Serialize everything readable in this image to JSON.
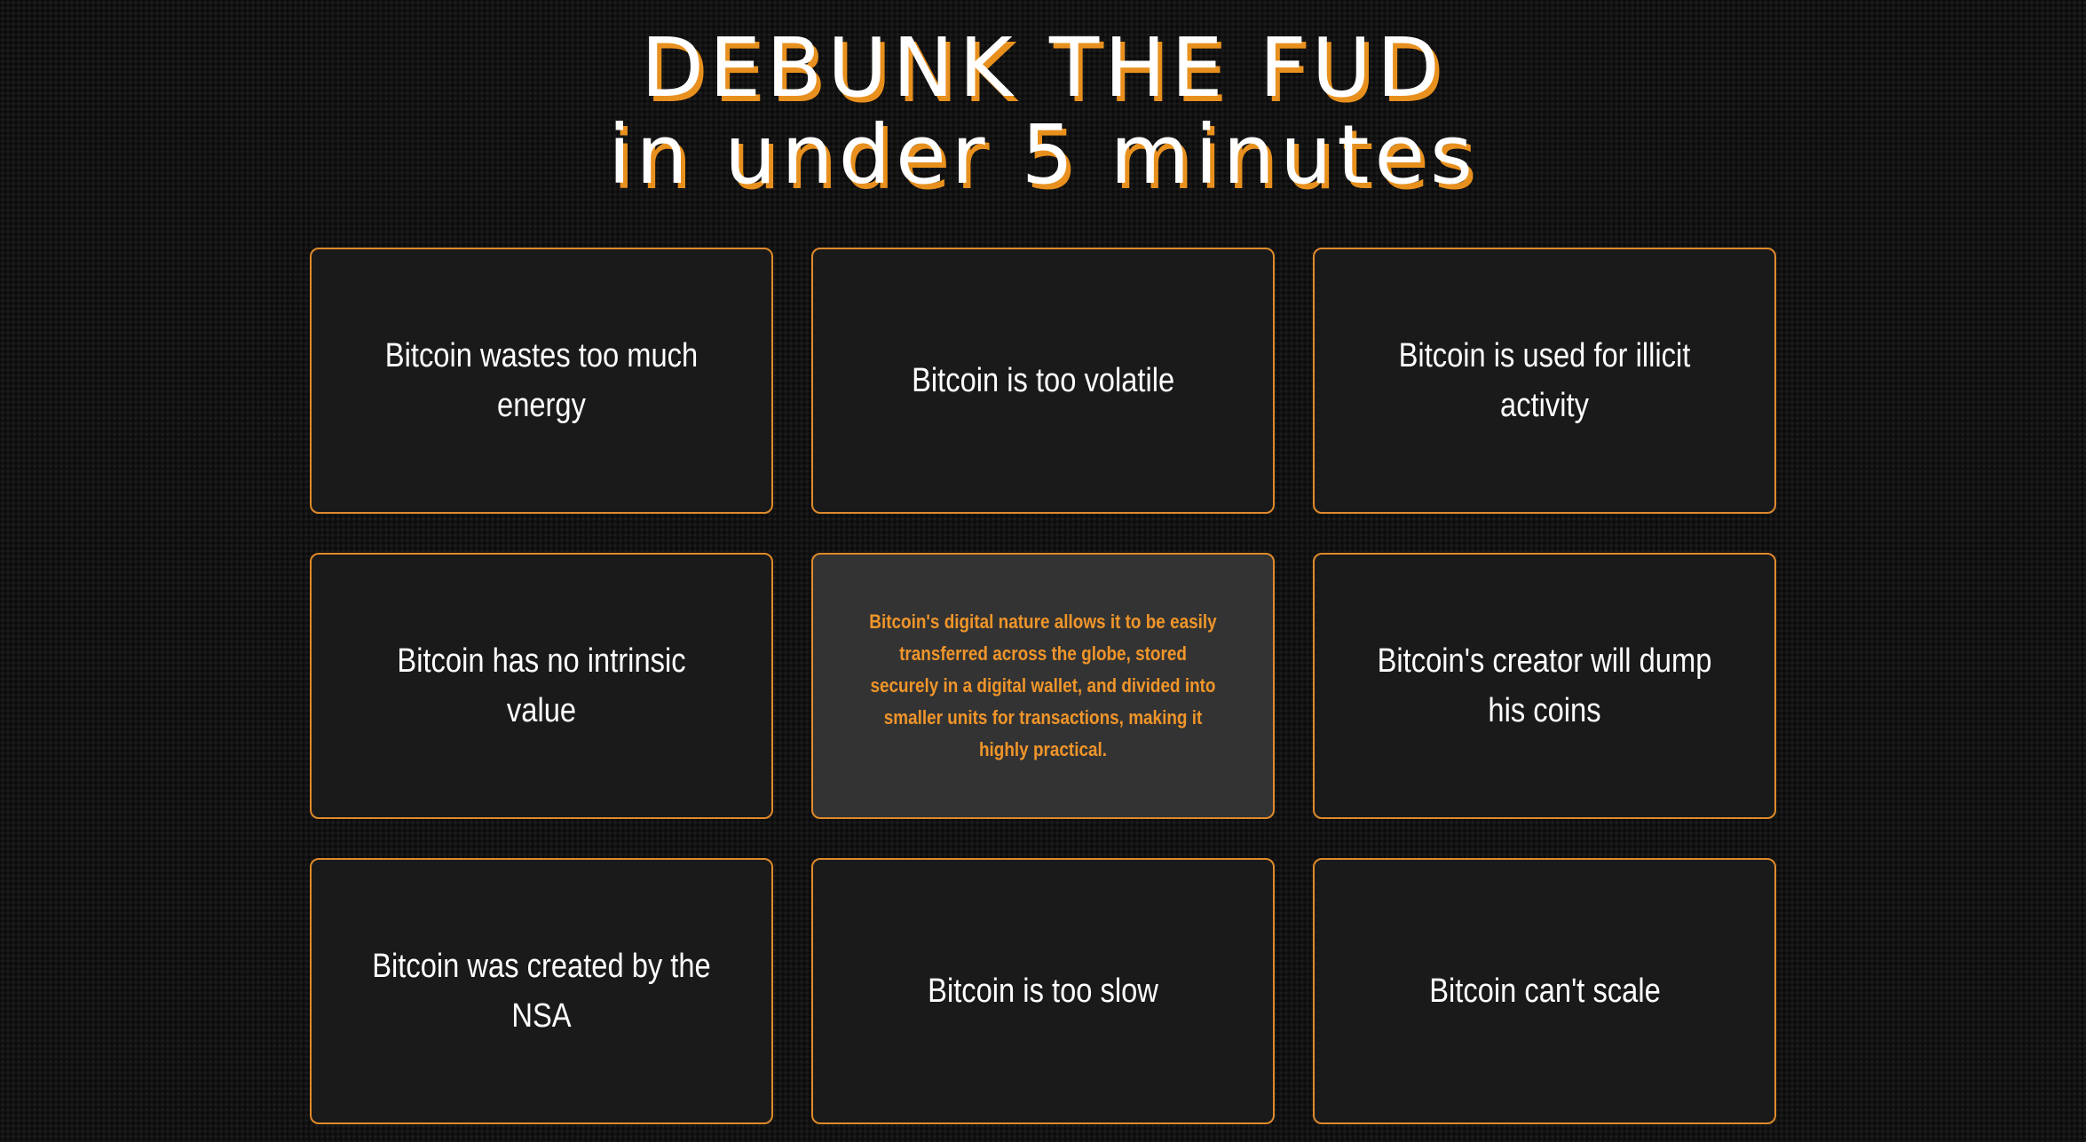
{
  "header": {
    "title_line1": "DEBUNK THE FUD",
    "title_line2": "in under 5 minutes"
  },
  "colors": {
    "accent": "#e8901e",
    "background": "#121212",
    "card_background": "#1a1a1a",
    "card_flipped_background": "#333333",
    "card_border": "#e08a2a"
  },
  "cards": [
    {
      "claim": "Bitcoin wastes too much energy"
    },
    {
      "claim": "Bitcoin is too volatile"
    },
    {
      "claim": "Bitcoin is used for illicit activity"
    },
    {
      "claim": "Bitcoin has no intrinsic value"
    },
    {
      "answer": "Bitcoin's digital nature allows it to be easily transferred across the globe, stored securely in a digital wallet, and divided into smaller units for transactions, making it highly practical."
    },
    {
      "claim": "Bitcoin's creator will dump his coins"
    },
    {
      "claim": "Bitcoin was created by the NSA"
    },
    {
      "claim": "Bitcoin is too slow"
    },
    {
      "claim": "Bitcoin can't scale"
    }
  ]
}
